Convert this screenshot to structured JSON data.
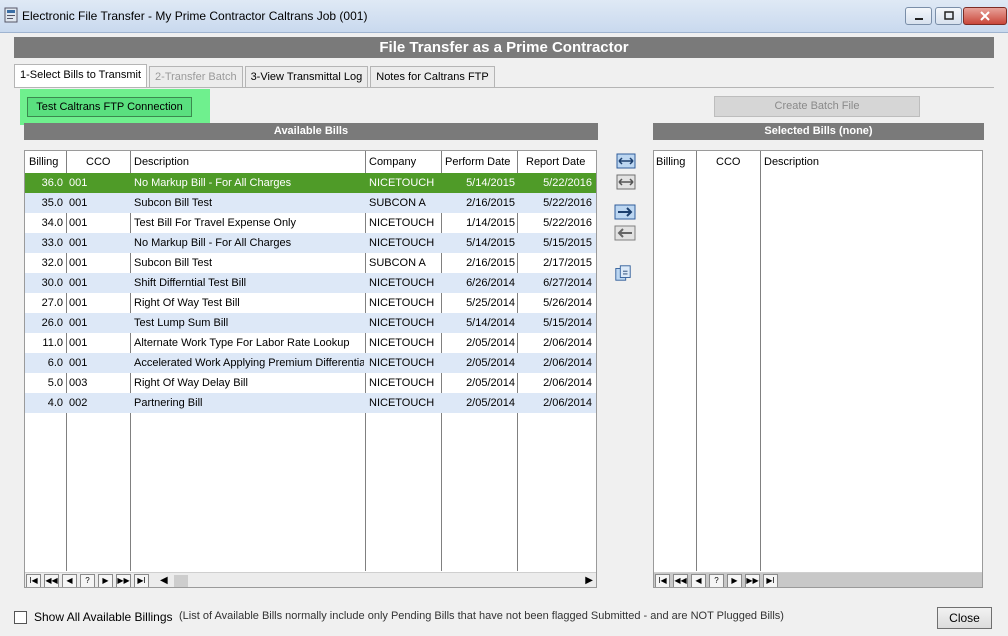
{
  "window": {
    "title": "Electronic File Transfer - My Prime Contractor Caltrans Job (001)"
  },
  "header": {
    "title": "File Transfer as a Prime Contractor"
  },
  "tabs": [
    {
      "label": "1-Select Bills to Transmit",
      "state": "active"
    },
    {
      "label": "2-Transfer Batch",
      "state": "disabled"
    },
    {
      "label": "3-View Transmittal Log",
      "state": "normal"
    },
    {
      "label": "Notes for Caltrans FTP",
      "state": "normal"
    }
  ],
  "buttons": {
    "test_ftp": "Test Caltrans FTP Connection",
    "create_batch": "Create Batch File",
    "close": "Close"
  },
  "available": {
    "title": "Available Bills",
    "columns": [
      "Billing",
      "CCO",
      "Description",
      "Company",
      "Perform Date",
      "Report Date"
    ],
    "rows": [
      [
        "36.0",
        "001",
        "No Markup Bill - For All Charges",
        "NICETOUCH",
        "5/14/2015",
        "5/22/2016"
      ],
      [
        "35.0",
        "001",
        "Subcon Bill Test",
        "SUBCON A",
        "2/16/2015",
        "5/22/2016"
      ],
      [
        "34.0",
        "001",
        "Test Bill For Travel Expense Only",
        "NICETOUCH",
        "1/14/2015",
        "5/22/2016"
      ],
      [
        "33.0",
        "001",
        "No Markup Bill - For All Charges",
        "NICETOUCH",
        "5/14/2015",
        "5/15/2015"
      ],
      [
        "32.0",
        "001",
        "Subcon Bill Test",
        "SUBCON A",
        "2/16/2015",
        "2/17/2015"
      ],
      [
        "30.0",
        "001",
        "Shift Differntial Test Bill",
        "NICETOUCH",
        "6/26/2014",
        "6/27/2014"
      ],
      [
        "27.0",
        "001",
        "Right Of Way Test Bill",
        "NICETOUCH",
        "5/25/2014",
        "5/26/2014"
      ],
      [
        "26.0",
        "001",
        "Test Lump Sum Bill",
        "NICETOUCH",
        "5/14/2014",
        "5/15/2014"
      ],
      [
        "11.0",
        "001",
        "Alternate Work Type For Labor Rate Lookup",
        "NICETOUCH",
        "2/05/2014",
        "2/06/2014"
      ],
      [
        "6.0",
        "001",
        "Accelerated Work Applying Premium Differential",
        "NICETOUCH",
        "2/05/2014",
        "2/06/2014"
      ],
      [
        "5.0",
        "003",
        "Right Of Way Delay Bill",
        "NICETOUCH",
        "2/05/2014",
        "2/06/2014"
      ],
      [
        "4.0",
        "002",
        "Partnering Bill",
        "NICETOUCH",
        "2/05/2014",
        "2/06/2014"
      ]
    ]
  },
  "selected": {
    "title": "Selected Bills (none)",
    "columns": [
      "Billing",
      "CCO",
      "Description"
    ]
  },
  "navigator": [
    "I◀",
    "◀◀",
    "◀",
    "?",
    "▶",
    "▶▶",
    "▶I"
  ],
  "footer": {
    "show_all_label": "Show All Available Billings",
    "note": "(List of Available Bills normally include only Pending Bills that have not been flagged Submitted - and are NOT Plugged Bills)"
  },
  "colors": {
    "selected_row": "#4f9b28",
    "alt_row": "#dde8f7",
    "header_gray": "#7a7a7a",
    "ftp_highlight": "#6ff08e"
  }
}
